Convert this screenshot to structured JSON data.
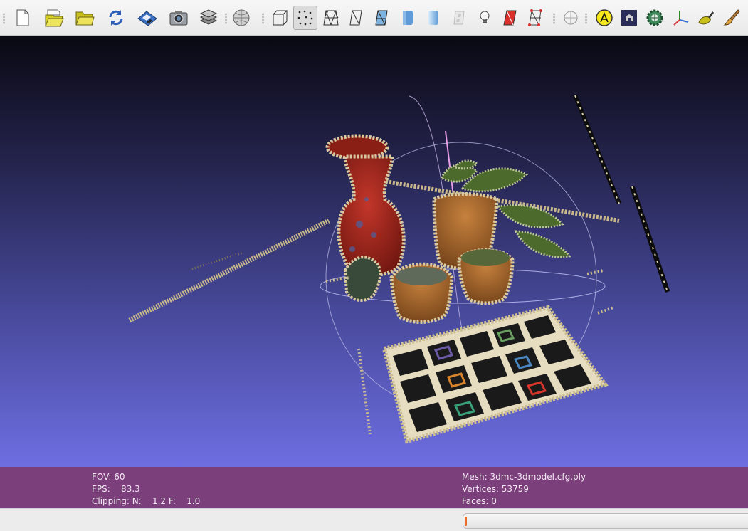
{
  "toolbar": {
    "buttons": [
      {
        "id": "new-project",
        "icon": "new-document-icon"
      },
      {
        "id": "open-project",
        "icon": "open-folder-stack-icon"
      },
      {
        "id": "import-mesh",
        "icon": "open-folder-icon"
      },
      {
        "id": "reload",
        "icon": "reload-arrows-icon"
      },
      {
        "id": "save",
        "icon": "floppy-save-icon"
      },
      {
        "id": "snapshot",
        "icon": "camera-icon"
      },
      {
        "id": "layers",
        "icon": "layers-icon"
      },
      {
        "id": "raster",
        "icon": "raster-globe-icon"
      },
      {
        "id": "bounding-box",
        "icon": "bounding-box-icon",
        "active": false
      },
      {
        "id": "points",
        "icon": "points-icon",
        "active": true
      },
      {
        "id": "wireframe",
        "icon": "wireframe-icon"
      },
      {
        "id": "hidden-lines",
        "icon": "hidden-lines-icon"
      },
      {
        "id": "flat-lines",
        "icon": "flat-lines-icon"
      },
      {
        "id": "flat",
        "icon": "flat-shading-icon"
      },
      {
        "id": "smooth",
        "icon": "smooth-shading-icon"
      },
      {
        "id": "texture",
        "icon": "texture-icon"
      },
      {
        "id": "lighting",
        "icon": "light-bulb-icon"
      },
      {
        "id": "backface-culling",
        "icon": "backface-culling-icon"
      },
      {
        "id": "selection-faces",
        "icon": "select-faces-icon"
      },
      {
        "id": "trackball",
        "icon": "trackball-icon"
      },
      {
        "id": "annotation",
        "icon": "annotation-a-icon"
      },
      {
        "id": "measure",
        "icon": "measure-icon"
      },
      {
        "id": "gear-filter",
        "icon": "gear-filter-icon"
      },
      {
        "id": "axes",
        "icon": "axes-icon"
      },
      {
        "id": "color-pick",
        "icon": "color-picker-icon"
      },
      {
        "id": "paint",
        "icon": "paint-brush-icon"
      }
    ]
  },
  "colors": {
    "viewport_top": "#090912",
    "viewport_bottom": "#6e6ee2",
    "info_bar": "#7b3f7c",
    "progress": "#e86b2c"
  },
  "info": {
    "fov": "FOV: 60",
    "fps": "FPS:    83.3",
    "clipping": "Clipping: N:    1.2 F:    1.0",
    "mesh": "Mesh: 3dmc-3dmodel.cfg.ply",
    "vertices": "Vertices: 53759",
    "faces": "Faces: 0"
  },
  "status": {
    "progress": 0.01
  }
}
